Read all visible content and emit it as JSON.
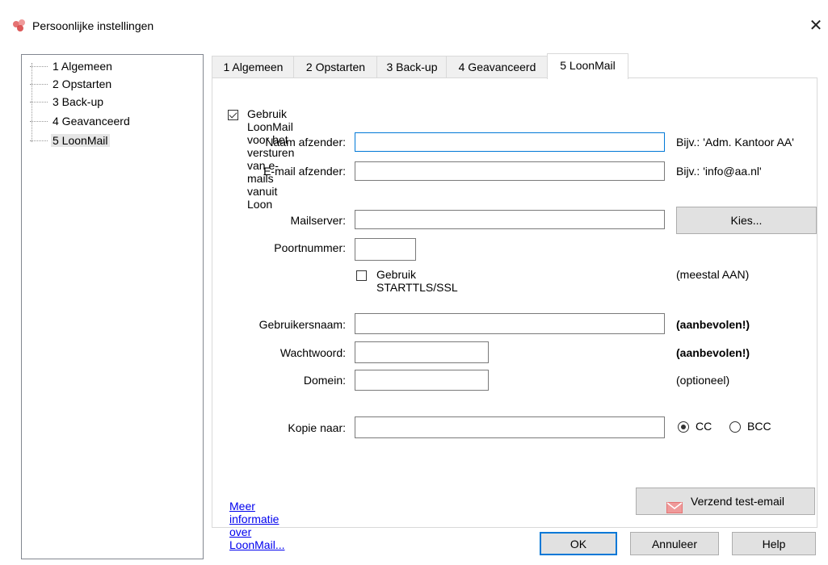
{
  "window": {
    "title": "Persoonlijke instellingen",
    "close_glyph": "✕"
  },
  "tree": {
    "items": [
      {
        "label": "1 Algemeen"
      },
      {
        "label": "2 Opstarten"
      },
      {
        "label": "3 Back-up"
      },
      {
        "label": "4 Geavanceerd"
      },
      {
        "label": "5 LoonMail",
        "selected": true
      }
    ]
  },
  "tabs": [
    {
      "label": "1 Algemeen"
    },
    {
      "label": "2 Opstarten"
    },
    {
      "label": "3 Back-up"
    },
    {
      "label": "4 Geavanceerd"
    },
    {
      "label": "5 LoonMail",
      "active": true
    }
  ],
  "form": {
    "use_loonmail": {
      "label": "Gebruik LoonMail voor het versturen van e-mails vanuit Loon",
      "checked": true
    },
    "sender_name": {
      "label": "Naam afzender:",
      "value": "",
      "hint": "Bijv.: 'Adm. Kantoor AA'"
    },
    "sender_email": {
      "label": "E-mail afzender:",
      "value": "",
      "hint": "Bijv.: 'info@aa.nl'"
    },
    "mailserver": {
      "label": "Mailserver:",
      "value": "",
      "button": "Kies..."
    },
    "port": {
      "label": "Poortnummer:",
      "value": ""
    },
    "starttls": {
      "label": "Gebruik STARTTLS/SSL",
      "checked": false,
      "hint": "(meestal AAN)"
    },
    "username": {
      "label": "Gebruikersnaam:",
      "value": "",
      "hint": "(aanbevolen!)"
    },
    "password": {
      "label": "Wachtwoord:",
      "value": "",
      "hint": "(aanbevolen!)"
    },
    "domain": {
      "label": "Domein:",
      "value": "",
      "hint": "(optioneel)"
    },
    "copy_to": {
      "label": "Kopie naar:",
      "value": "",
      "cc_label": "CC",
      "bcc_label": "BCC",
      "selected": "CC"
    },
    "info_link": "Meer informatie over LoonMail...",
    "test_button": "Verzend test-email"
  },
  "footer": {
    "ok": "OK",
    "cancel": "Annuleer",
    "help": "Help"
  },
  "colors": {
    "accent": "#0078d7",
    "link": "#0000ee",
    "app_icon": "#e57373"
  }
}
